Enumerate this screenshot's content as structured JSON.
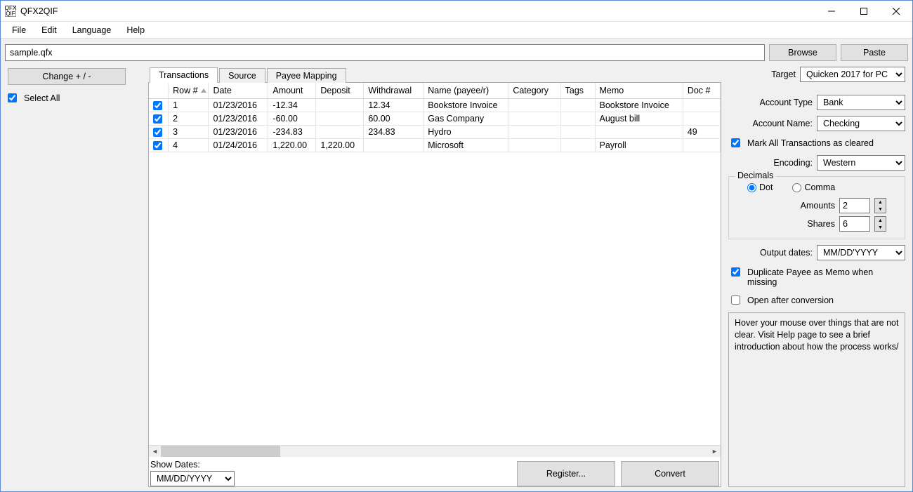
{
  "window": {
    "title": "QFX2QIF"
  },
  "menu": {
    "items": [
      "File",
      "Edit",
      "Language",
      "Help"
    ]
  },
  "file": {
    "path": "sample.qfx",
    "browse": "Browse",
    "paste": "Paste"
  },
  "left": {
    "change_btn": "Change + / -",
    "select_all": "Select All"
  },
  "tabs": {
    "items": [
      "Transactions",
      "Source",
      "Payee Mapping"
    ],
    "active": 0
  },
  "grid": {
    "headers": {
      "row": "Row #",
      "date": "Date",
      "amount": "Amount",
      "deposit": "Deposit",
      "withdrawal": "Withdrawal",
      "name": "Name (payee/r)",
      "category": "Category",
      "tags": "Tags",
      "memo": "Memo",
      "doc": "Doc #"
    },
    "rows": [
      {
        "checked": true,
        "row": "1",
        "date": "01/23/2016",
        "amount": "-12.34",
        "deposit": "",
        "withdrawal": "12.34",
        "name": "Bookstore Invoice",
        "category": "",
        "tags": "",
        "memo": "Bookstore Invoice",
        "doc": ""
      },
      {
        "checked": true,
        "row": "2",
        "date": "01/23/2016",
        "amount": "-60.00",
        "deposit": "",
        "withdrawal": "60.00",
        "name": "Gas Company",
        "category": "",
        "tags": "",
        "memo": "August bill",
        "doc": ""
      },
      {
        "checked": true,
        "row": "3",
        "date": "01/23/2016",
        "amount": "-234.83",
        "deposit": "",
        "withdrawal": "234.83",
        "name": "Hydro",
        "category": "",
        "tags": "",
        "memo": "",
        "doc": "49"
      },
      {
        "checked": true,
        "row": "4",
        "date": "01/24/2016",
        "amount": "1,220.00",
        "deposit": "1,220.00",
        "withdrawal": "",
        "name": "Microsoft",
        "category": "",
        "tags": "",
        "memo": "Payroll",
        "doc": ""
      }
    ]
  },
  "bottom": {
    "show_dates_label": "Show Dates:",
    "show_dates_value": "MM/DD/YYYY",
    "register_btn": "Register...",
    "convert_btn": "Convert"
  },
  "right": {
    "target_label": "Target",
    "target_value": "Quicken 2017 for PC",
    "account_type_label": "Account Type",
    "account_type_value": "Bank",
    "account_name_label": "Account Name:",
    "account_name_value": "Checking",
    "mark_cleared": "Mark All Transactions as cleared",
    "encoding_label": "Encoding:",
    "encoding_value": "Western",
    "decimals_legend": "Decimals",
    "dot": "Dot",
    "comma": "Comma",
    "amounts_label": "Amounts",
    "amounts_value": "2",
    "shares_label": "Shares",
    "shares_value": "6",
    "output_dates_label": "Output dates:",
    "output_dates_value": "MM/DD'YYYY",
    "dup_payee": "Duplicate Payee as Memo when missing",
    "open_after": "Open after conversion",
    "hint": "Hover your mouse over things that are not clear. Visit Help page to see a brief introduction about how the process works/"
  }
}
